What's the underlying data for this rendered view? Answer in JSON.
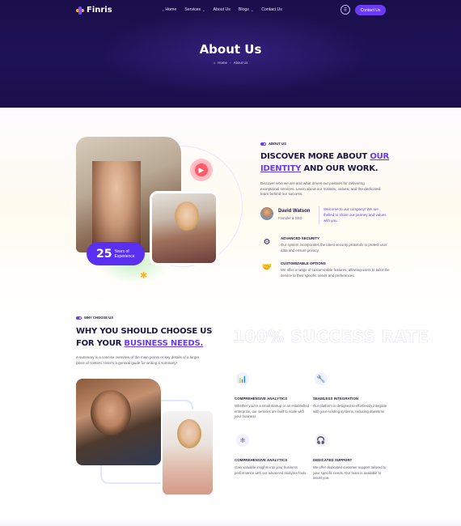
{
  "brand": {
    "name": "Finris"
  },
  "nav": {
    "items": [
      {
        "label": "Home"
      },
      {
        "label": "Services"
      },
      {
        "label": "About Us"
      },
      {
        "label": "Blogs"
      },
      {
        "label": "Contact Us"
      }
    ],
    "contact_button": "Contact Us"
  },
  "hero": {
    "title": "About Us",
    "breadcrumb": {
      "home": "Home",
      "separator": "›",
      "current": "About Us"
    }
  },
  "about": {
    "tag": "ABOUT US",
    "heading_part1": "DISCOVER MORE ABOUT ",
    "heading_highlight": "OUR IDENTITY",
    "heading_part2": " AND OUR WORK.",
    "paragraph": "Discover who we are and what drives our passion for delivering exceptional services. Learn about our mission, values, and the dedicated team behind our success.",
    "experience_number": "25",
    "experience_label_1": "Years of",
    "experience_label_2": "Experience",
    "person": {
      "name": "David Watson",
      "role": "Founder & SEO"
    },
    "quote": "Welcome to our company! We are thrilled to share our journey and values with you.",
    "features": [
      {
        "icon": "security-icon",
        "title": "ADVANCED SECURITY",
        "text": "Our system incorporates the latest security protocols to protect user data and ensure privacy."
      },
      {
        "icon": "handshake-icon",
        "title": "CUSTOMIZABLE OPTIONS",
        "text": "We offer a range of customizable features, allowing users to tailor the service to their specific needs and preferences."
      }
    ]
  },
  "why": {
    "tag": "WHY CHOOSE US",
    "heading_part1": "WHY YOU SHOULD CHOOSE US FOR YOUR ",
    "heading_highlight": "BUSINESS NEEDS.",
    "paragraph": "A summary is a concise overview of the main points or key details of a larger piece of content. Here's a general guide for writing a summary!",
    "watermark": "100% SUCCESS RATE",
    "features": [
      {
        "icon": "analytics-icon",
        "title": "COMPREHENSIVE ANALYTICS",
        "text": "Whether you're a small startup or an established enterprise, our services are built to scale with your business"
      },
      {
        "icon": "integration-icon",
        "title": "SEAMLESS INTEGRATION",
        "text": "Our platform is designed to effortlessly integrate with your existing systems, reducing downtime"
      },
      {
        "icon": "insights-icon",
        "title": "COMPREHENSIVE ANALYTICS",
        "text": "Gain valuable insights into your business performance with our advanced analytics tools."
      },
      {
        "icon": "support-icon",
        "title": "DEDICATED SUPPORT",
        "text": "We offer dedicated customer support tailored to your specific needs. Our team is available to assist you."
      }
    ]
  },
  "colors": {
    "primary": "#6a3bf5",
    "hero_bg": "#1e1257",
    "accent_yellow": "#f5b21c",
    "text_dark": "#1b1740"
  }
}
